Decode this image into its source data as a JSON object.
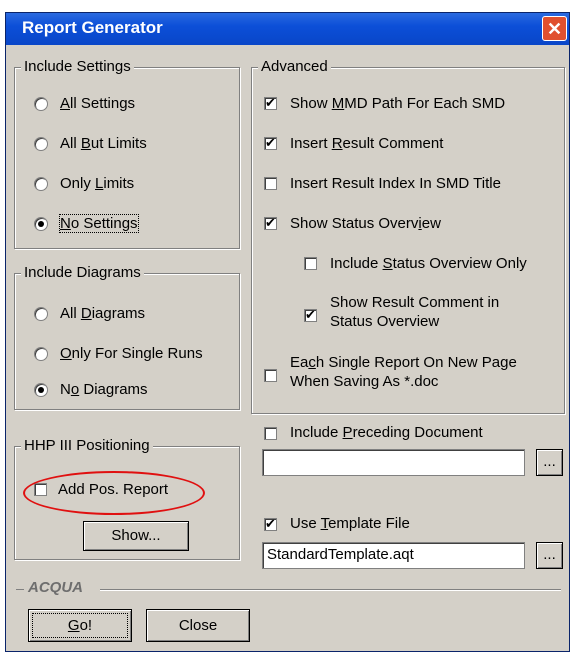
{
  "window": {
    "title": "Report Generator",
    "close_symbol": "✕"
  },
  "include_settings": {
    "legend": "Include Settings",
    "options": [
      {
        "pre": "",
        "u": "A",
        "post": "ll Settings",
        "checked": false
      },
      {
        "pre": "All ",
        "u": "B",
        "post": "ut Limits",
        "checked": false
      },
      {
        "pre": "Only ",
        "u": "L",
        "post": "imits",
        "checked": false
      },
      {
        "pre": "",
        "u": "N",
        "post": "o Settings",
        "checked": true
      }
    ]
  },
  "include_diagrams": {
    "legend": "Include Diagrams",
    "options": [
      {
        "pre": "All ",
        "u": "D",
        "post": "iagrams",
        "checked": false
      },
      {
        "pre": "",
        "u": "O",
        "post": "nly For Single Runs",
        "checked": false
      },
      {
        "pre": "N",
        "u": "o",
        "post": " Diagrams",
        "checked": true
      }
    ]
  },
  "hhp": {
    "legend": "HHP III Positioning",
    "add_pos_label": "Add Pos. Report",
    "show_button": "Show..."
  },
  "advanced": {
    "legend": "Advanced",
    "show_mmd": {
      "pre": "Show ",
      "u": "M",
      "post": "MD Path For Each SMD",
      "checked": true
    },
    "insert_comment": {
      "pre": "Insert ",
      "u": "R",
      "post": "esult Comment",
      "checked": true
    },
    "insert_index": {
      "label": "Insert Result Index In SMD Title",
      "checked": false
    },
    "show_status": {
      "pre": "Show Status Overv",
      "u": "i",
      "post": "ew",
      "checked": true
    },
    "include_status_only": {
      "pre": "Include ",
      "u": "S",
      "post": "tatus Overview Only",
      "checked": false
    },
    "show_result_comment": {
      "line1": "Show Result Comment in",
      "line2": "Status Overview",
      "checked": true
    },
    "each_report": {
      "pre": "Ea",
      "u": "c",
      "post": "h Single Report On New Page",
      "line2": "When Saving As *.doc",
      "checked": false
    }
  },
  "preceding": {
    "pre": "Include ",
    "u": "P",
    "post": "receding Document",
    "checked": false,
    "value": "",
    "browse": "..."
  },
  "template": {
    "pre": "Use ",
    "u": "T",
    "post": "emplate File",
    "checked": true,
    "value": "StandardTemplate.aqt",
    "browse": "..."
  },
  "brand": "ACQUA",
  "buttons": {
    "go_u": "G",
    "go_post": "o!",
    "close": "Close"
  }
}
